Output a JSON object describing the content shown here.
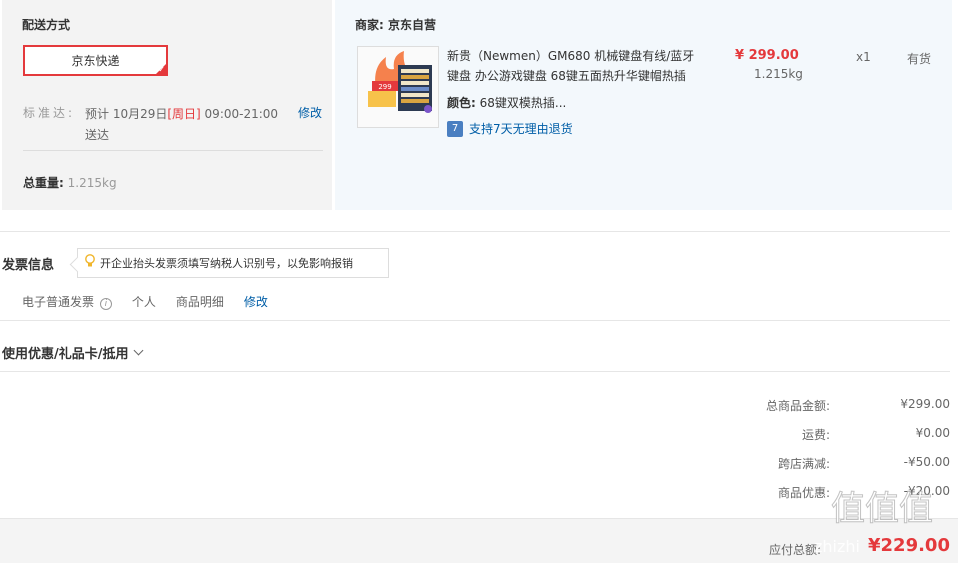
{
  "shipping": {
    "title": "配送方式",
    "method": "京东快递",
    "eta_label": "标准达:",
    "eta_prefix": "预计 10月29日",
    "eta_day": "[周日]",
    "eta_suffix": " 09:00-21:00 送达",
    "edit": "修改",
    "weight_label": "总重量:",
    "weight_value": "1.215kg"
  },
  "product": {
    "merchant": "商家: 京东自营",
    "name": "新贵（Newmen）GM680 机械键盘有线/蓝牙键盘 办公游戏键盘 68键五面热升华键帽热插",
    "price": "¥ 299.00",
    "weight": "1.215kg",
    "qty": "x1",
    "stock": "有货",
    "color_label": "颜色:",
    "color_value": "68键双模热插...",
    "return_text": "支持7天无理由退货",
    "return_icon": "7"
  },
  "invoice": {
    "title": "发票信息",
    "tip": "开企业抬头发票须填写纳税人识别号，以免影响报销",
    "type": "电子普通发票",
    "holder": "个人",
    "content": "商品明细",
    "edit": "修改"
  },
  "promo": {
    "title": "使用优惠/礼品卡/抵用"
  },
  "summary": {
    "rows": [
      {
        "label": "总商品金额:",
        "value": "¥299.00"
      },
      {
        "label": "运费:",
        "value": "¥0.00"
      },
      {
        "label": "跨店满减:",
        "value": "-¥50.00"
      },
      {
        "label": "商品优惠:",
        "value": "-¥20.00"
      }
    ],
    "pay_label": "应付总额:",
    "pay_value": "¥229.00"
  },
  "watermark": {
    "site": "zhizhi",
    "logo": "值值值"
  },
  "colors": {
    "accent_red": "#e4393c",
    "link_blue": "#005ea7"
  }
}
